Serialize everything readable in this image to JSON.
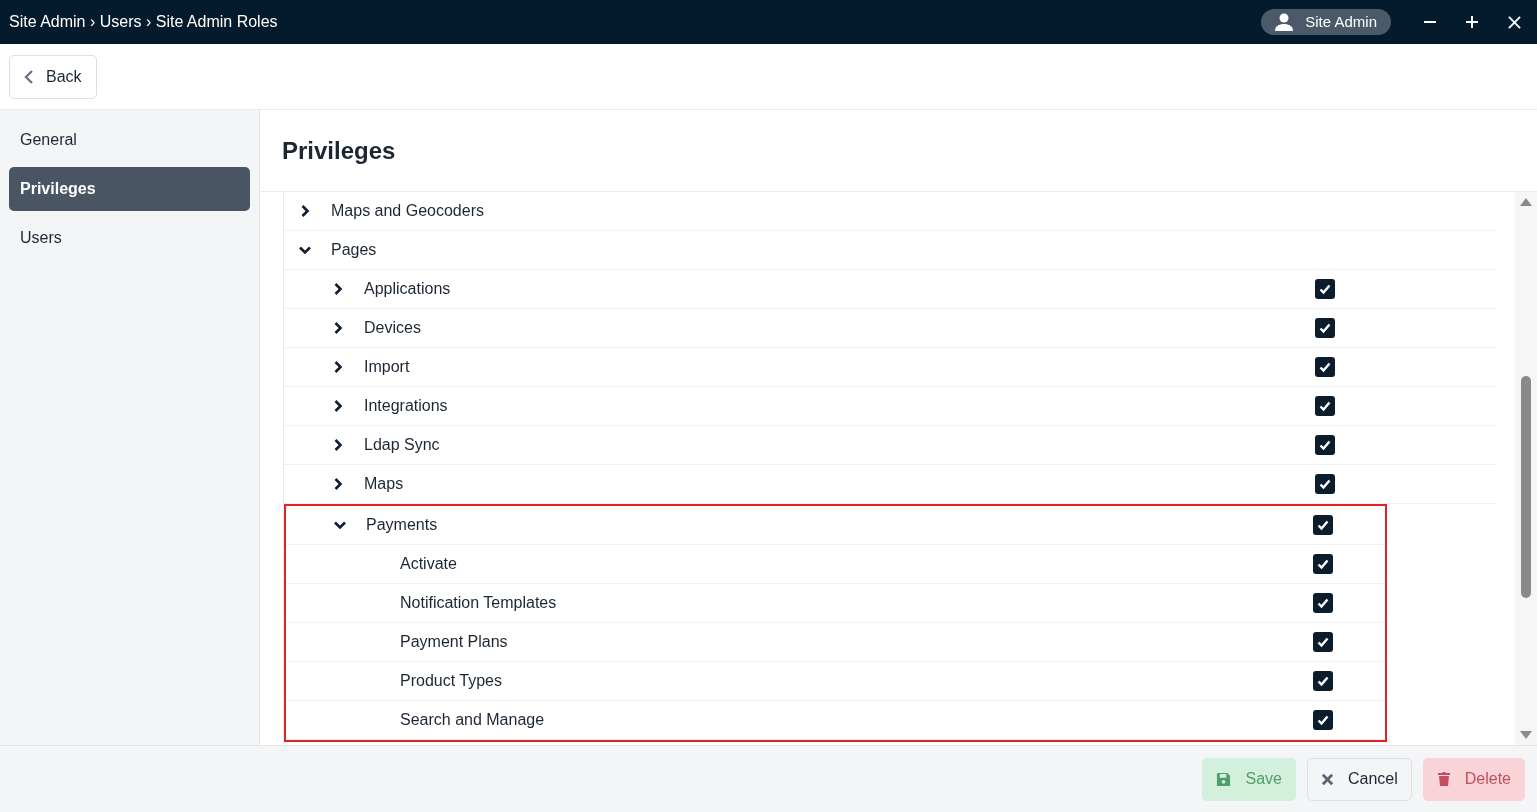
{
  "title_bar": {
    "breadcrumb": "Site Admin › Users › Site Admin Roles",
    "user": "Site Admin"
  },
  "back_button": {
    "label": "Back"
  },
  "sidebar": {
    "items": [
      {
        "label": "General",
        "selected": false
      },
      {
        "label": "Privileges",
        "selected": true
      },
      {
        "label": "Users",
        "selected": false
      }
    ]
  },
  "section_title": "Privileges",
  "tree": [
    {
      "label": "Maps and Geocoders",
      "expanded": false
    },
    {
      "label": "Pages",
      "expanded": true,
      "children": [
        {
          "label": "Applications",
          "expanded": false,
          "checked": true,
          "highlighted": false
        },
        {
          "label": "Devices",
          "expanded": false,
          "checked": true,
          "highlighted": false
        },
        {
          "label": "Import",
          "expanded": false,
          "checked": true,
          "highlighted": false
        },
        {
          "label": "Integrations",
          "expanded": false,
          "checked": true,
          "highlighted": false
        },
        {
          "label": "Ldap Sync",
          "expanded": false,
          "checked": true,
          "highlighted": false
        },
        {
          "label": "Maps",
          "expanded": false,
          "checked": true,
          "highlighted": false
        },
        {
          "label": "Payments",
          "expanded": true,
          "checked": true,
          "highlighted": true,
          "children": [
            {
              "label": "Activate",
              "checked": true
            },
            {
              "label": "Notification Templates",
              "checked": true
            },
            {
              "label": "Payment Plans",
              "checked": true
            },
            {
              "label": "Product Types",
              "checked": true
            },
            {
              "label": "Search and Manage",
              "checked": true
            }
          ]
        }
      ]
    }
  ],
  "footer_buttons": [
    {
      "kind": "save",
      "label": "Save",
      "disabled": true
    },
    {
      "kind": "cancel",
      "label": "Cancel",
      "disabled": false
    },
    {
      "kind": "delete",
      "label": "Delete",
      "disabled": true
    }
  ]
}
